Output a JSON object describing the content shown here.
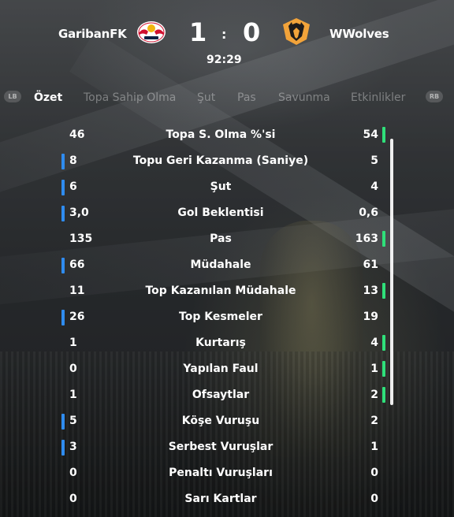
{
  "match": {
    "home": {
      "name": "GaribanFK",
      "score": "1",
      "crest_icon": "rb-leipzig-crest-icon"
    },
    "away": {
      "name": "WWolves",
      "score": "0",
      "crest_icon": "wolves-crest-icon"
    },
    "separator": ":",
    "clock": "92:29"
  },
  "colors": {
    "home_lead": "#2f8cf0",
    "away_lead": "#2fe07a"
  },
  "tabs": {
    "lb": "LB",
    "rb": "RB",
    "items": [
      {
        "label": "Özet",
        "active": true
      },
      {
        "label": "Topa Sahip Olma",
        "active": false
      },
      {
        "label": "Şut",
        "active": false
      },
      {
        "label": "Pas",
        "active": false
      },
      {
        "label": "Savunma",
        "active": false
      },
      {
        "label": "Etkinlikler",
        "active": false
      }
    ]
  },
  "stats": [
    {
      "label": "Topa S. Olma %'si",
      "home": "46",
      "away": "54",
      "leader": "away"
    },
    {
      "label": "Topu Geri Kazanma (Saniye)",
      "home": "8",
      "away": "5",
      "leader": "home"
    },
    {
      "label": "Şut",
      "home": "6",
      "away": "4",
      "leader": "home"
    },
    {
      "label": "Gol Beklentisi",
      "home": "3,0",
      "away": "0,6",
      "leader": "home"
    },
    {
      "label": "Pas",
      "home": "135",
      "away": "163",
      "leader": "away"
    },
    {
      "label": "Müdahale",
      "home": "66",
      "away": "61",
      "leader": "home"
    },
    {
      "label": "Top Kazanılan Müdahale",
      "home": "11",
      "away": "13",
      "leader": "away"
    },
    {
      "label": "Top Kesmeler",
      "home": "26",
      "away": "19",
      "leader": "home"
    },
    {
      "label": "Kurtarış",
      "home": "1",
      "away": "4",
      "leader": "away"
    },
    {
      "label": "Yapılan Faul",
      "home": "0",
      "away": "1",
      "leader": "away"
    },
    {
      "label": "Ofsaytlar",
      "home": "1",
      "away": "2",
      "leader": "away"
    },
    {
      "label": "Köşe Vuruşu",
      "home": "5",
      "away": "2",
      "leader": "home"
    },
    {
      "label": "Serbest Vuruşlar",
      "home": "3",
      "away": "1",
      "leader": "home"
    },
    {
      "label": "Penaltı Vuruşları",
      "home": "0",
      "away": "0",
      "leader": "none"
    },
    {
      "label": "Sarı Kartlar",
      "home": "0",
      "away": "0",
      "leader": "none"
    }
  ]
}
